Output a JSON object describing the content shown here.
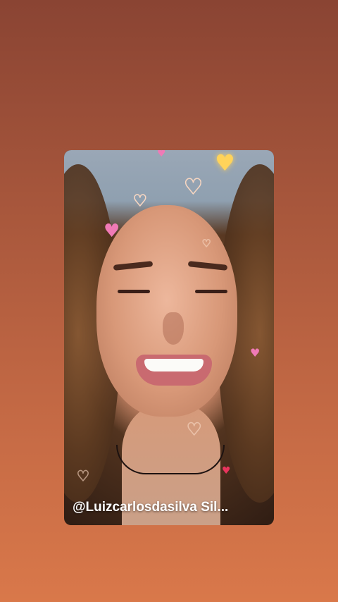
{
  "story": {
    "username_caption": "@Luizcarlosdasilva Sil...",
    "accent_colors": {
      "pink_heart": "#f07ab6",
      "gold_heart": "#ffd35a",
      "red_heart": "#e8345d",
      "outline_heart": "#f7d6c1"
    },
    "icons": [
      "heart-icon"
    ]
  }
}
